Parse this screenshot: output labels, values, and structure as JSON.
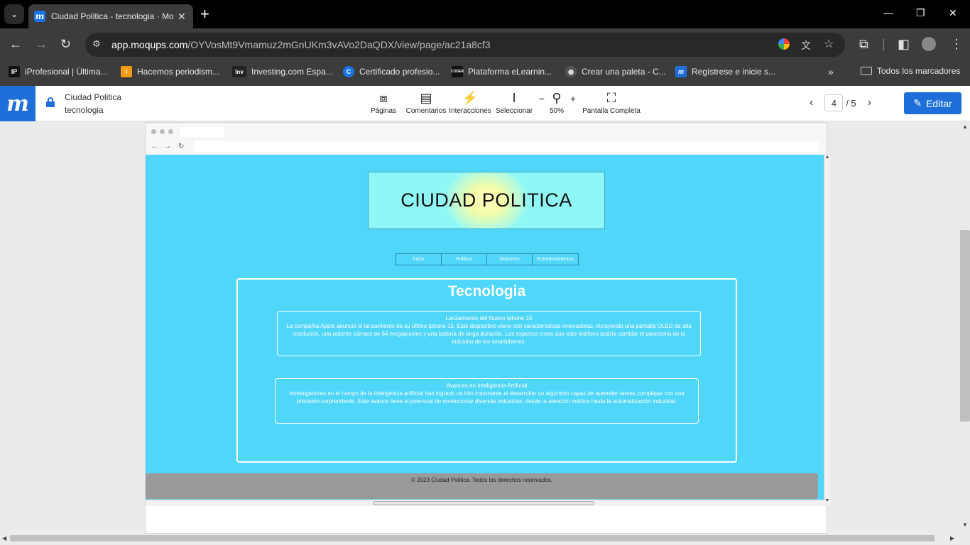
{
  "browser": {
    "tab_title": "Ciudad Politica - tecnologia · Moqups",
    "url_host": "app.moqups.com",
    "url_path": "/OYVosMt9Vmamuz2mGnUKm3vAVo2DaQDX/view/page/ac21a8cf3",
    "bookmarks": [
      {
        "label": "iProfesional | Última...",
        "icon": "iP",
        "color": "#111111"
      },
      {
        "label": "Hacemos periodism...",
        "icon": "i",
        "color": "#f39c12"
      },
      {
        "label": "Investing.com Espa...",
        "icon": "Inv",
        "color": "#222222"
      },
      {
        "label": "Certificado profesio...",
        "icon": "C",
        "color": "#1a73e8"
      },
      {
        "label": "Plataforma eLearnin...",
        "icon": "CODER",
        "color": "#111111"
      },
      {
        "label": "Crear una paleta - C...",
        "icon": "globe",
        "color": "#555555"
      },
      {
        "label": "Regístrese e inicie s...",
        "icon": "m",
        "color": "#1e6fd9"
      }
    ],
    "all_bookmarks": "Todos los marcadores"
  },
  "moqups": {
    "project_name": "Ciudad Politica",
    "page_name": "tecnologia",
    "tools": [
      {
        "label": "Páginas",
        "icon": "pages-icon"
      },
      {
        "label": "Comentarios",
        "icon": "comments-icon"
      },
      {
        "label": "Interacciones",
        "icon": "bolt-icon"
      },
      {
        "label": "Seleccionar",
        "icon": "cursor-icon"
      },
      {
        "label": "50%",
        "icon": "zoom-icon"
      },
      {
        "label": "Pantalla Completa",
        "icon": "fullscreen-icon"
      }
    ],
    "zoom_minus": "−",
    "zoom_plus": "+",
    "page_current": "4",
    "page_total": "/ 5",
    "edit_label": "Editar"
  },
  "site": {
    "hero_title": "CIUDAD POLITICA",
    "menu": [
      "Inicio",
      "Politica",
      "Deportes",
      "Entretenimientos"
    ],
    "section_title": "Tecnologia",
    "articles": [
      {
        "title": "Lanzamiento del Nuevo Iphone 15",
        "body": "La compañía Apple anunció el lanzamiento de su último Iphone 15. Este dispositivo viene con características innovadoras, incluyendo una pantalla OLED de alta resolución, una potente cámara de 64 megapíxeles y una batería de larga duración. Los expertos creen que este teléfono podría cambiar el panorama de la industria de los smartphones."
      },
      {
        "title": "Avances en Inteligencia Artificial",
        "body": "Investigadores en el campo de la inteligencia artificial han logrado un hito importante al desarrollar un algoritmo capaz de aprender tareas complejas con una precisión sorprendente. Este avance tiene el potencial de revolucionar diversas industrias, desde la atención médica hasta la automatización industrial."
      }
    ],
    "footer": "© 2023 Ciudad Politica. Todos los derechos reservados."
  },
  "colors": {
    "site_background": "#4fd6f8",
    "moqups_blue": "#1e6fd9",
    "footer": "#9a9a9a"
  }
}
